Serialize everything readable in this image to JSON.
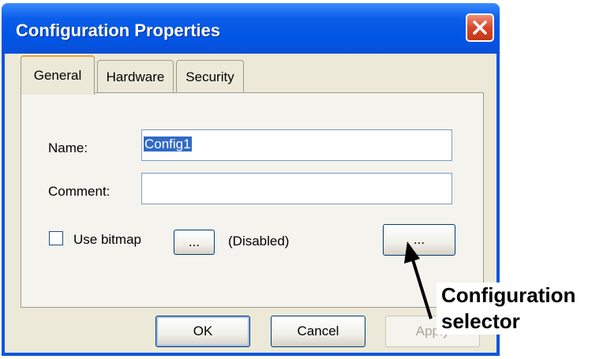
{
  "window": {
    "title": "Configuration Properties",
    "close_label": "close"
  },
  "tabs": [
    {
      "label": "General",
      "active": true
    },
    {
      "label": "Hardware",
      "active": false
    },
    {
      "label": "Security",
      "active": false
    }
  ],
  "form": {
    "name_label": "Name:",
    "name_value": "Config1",
    "comment_label": "Comment:",
    "comment_value": "",
    "use_bitmap_label": "Use bitmap",
    "use_bitmap_checked": false,
    "bitmap_browse_label": "...",
    "bitmap_status": "(Disabled)",
    "config_selector_label": "..."
  },
  "buttons": {
    "ok": "OK",
    "cancel": "Cancel",
    "apply": "Apply"
  },
  "annotation": {
    "line1": "Configuration",
    "line2": "selector"
  },
  "colors": {
    "titlebar": "#0055e5",
    "dialog_bg": "#ece9d8",
    "close_button": "#d9472a",
    "selection": "#316ac5"
  }
}
